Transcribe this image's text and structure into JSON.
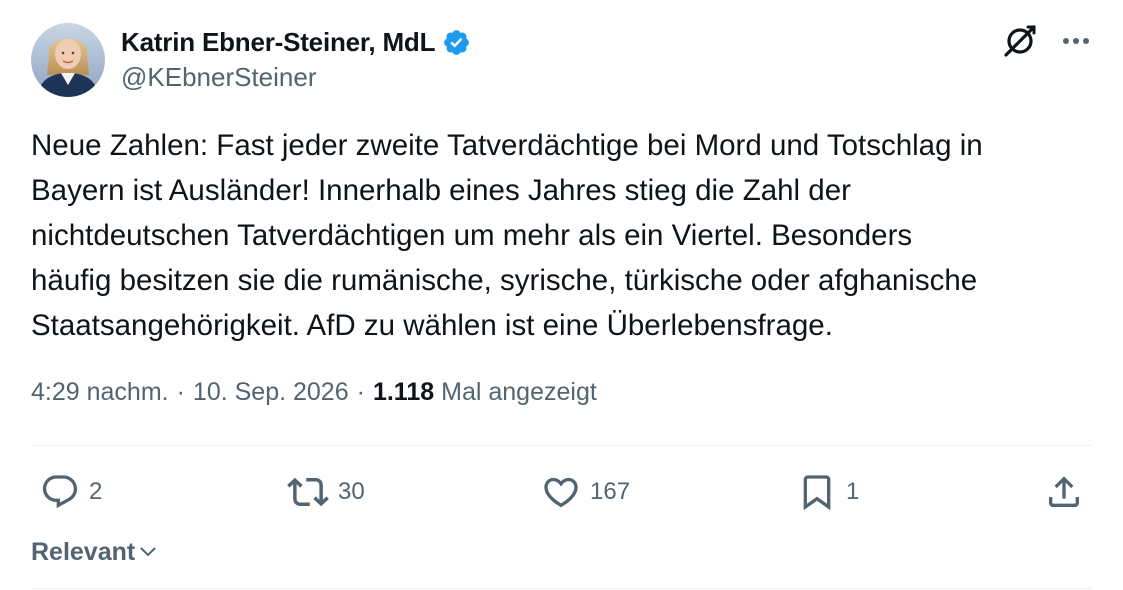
{
  "author": {
    "display_name": "Katrin Ebner-Steiner, MdL",
    "handle": "@KEbnerSteiner",
    "verified": true
  },
  "tweet": {
    "text": "Neue Zahlen: Fast jeder zweite Tatverdächtige bei Mord und Totschlag in\nBayern ist Ausländer! Innerhalb eines Jahres stieg die Zahl der\nnichtdeutschen Tatverdächtigen um mehr als ein Viertel. Besonders\nhäufig besitzen sie die rumänische, syrische, türkische oder afghanische\nStaatsangehörigkeit. AfD zu wählen ist eine Überlebensfrage.",
    "time": "4:29 nachm.",
    "separator": "·",
    "date": "10. Sep. 2026",
    "views_count": "1.118",
    "views_label": "Mal angezeigt"
  },
  "actions": {
    "replies": "2",
    "reposts": "30",
    "likes": "167",
    "bookmarks": "1"
  },
  "sort": {
    "label": "Relevant"
  },
  "icons": {
    "verified": "verified-badge-icon",
    "grok": "grok-icon",
    "more": "more-icon",
    "reply": "reply-icon",
    "repost": "repost-icon",
    "like": "heart-icon",
    "bookmark": "bookmark-icon",
    "share": "share-icon",
    "chevron": "chevron-down-icon"
  },
  "colors": {
    "text_primary": "#0f1419",
    "text_secondary": "#536471",
    "verified_blue": "#1d9bf0",
    "divider": "#eff3f4"
  }
}
